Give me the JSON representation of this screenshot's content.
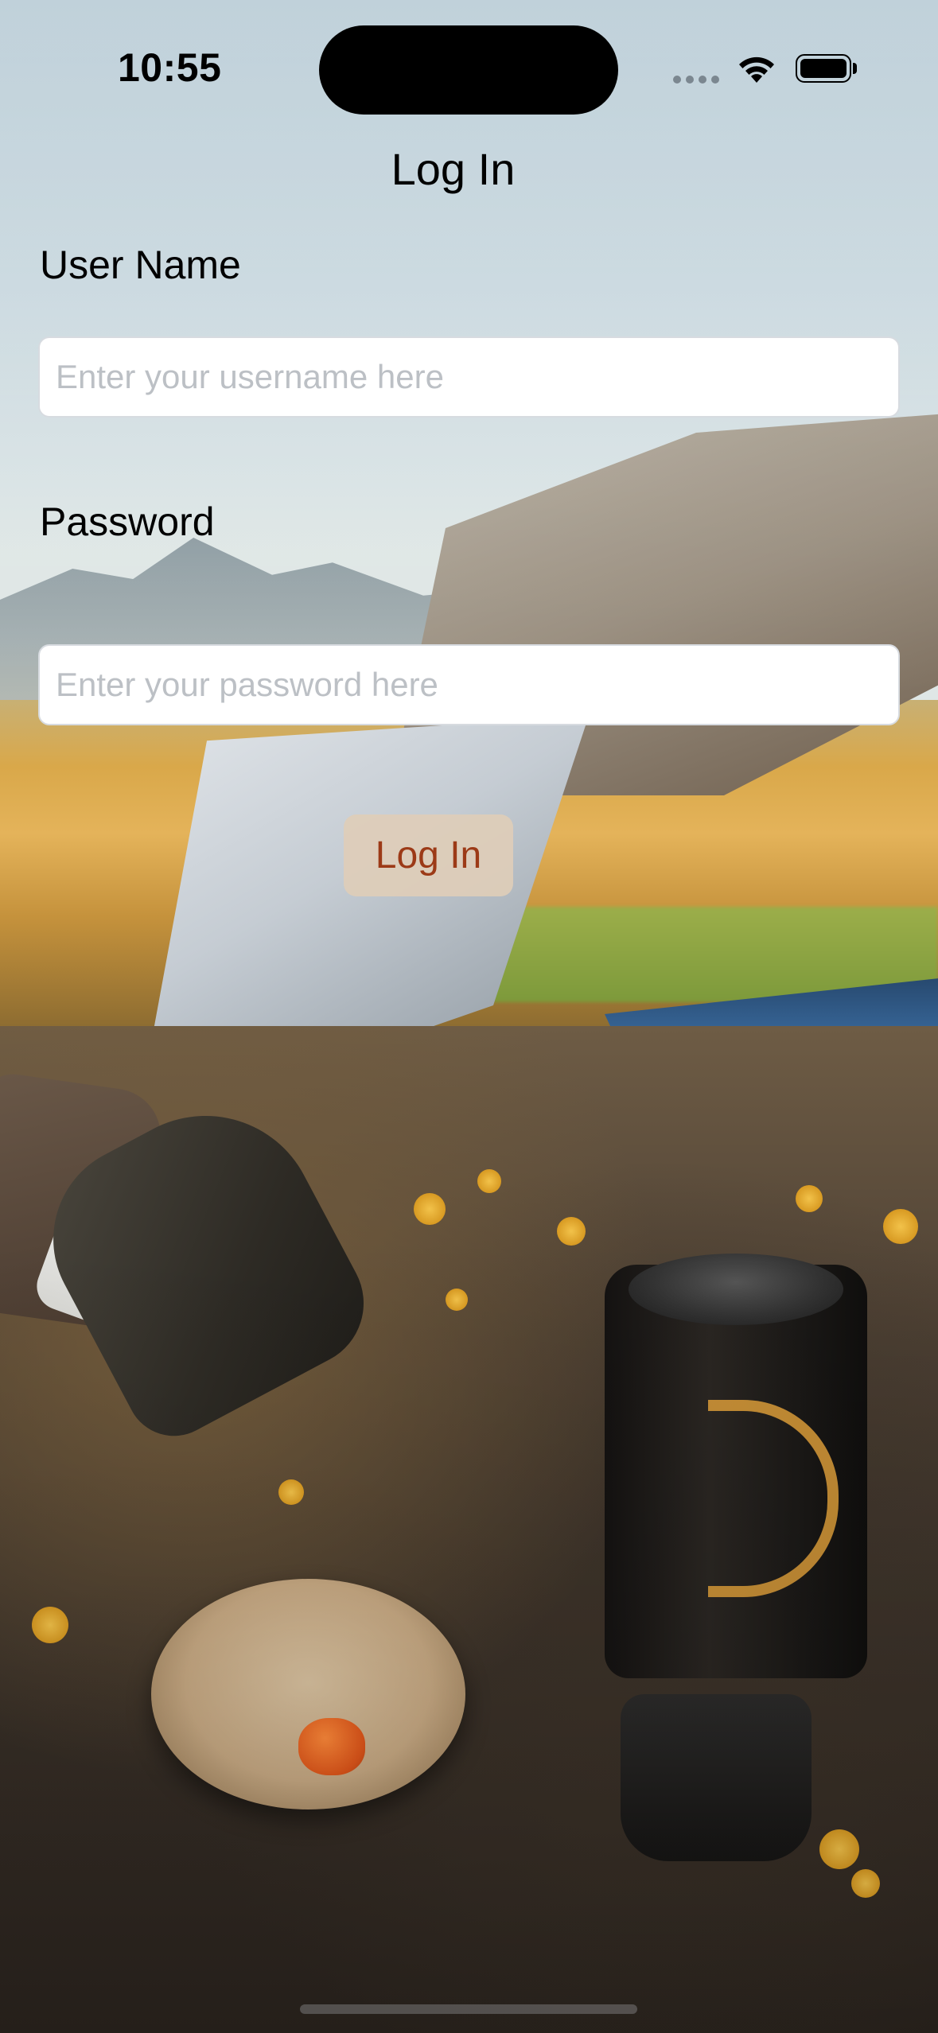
{
  "status_bar": {
    "time": "10:55",
    "icons": [
      "signal-dots-icon",
      "wifi-icon",
      "battery-icon"
    ],
    "battery_level": 1.0
  },
  "nav": {
    "title": "Log In"
  },
  "form": {
    "username_label": "User Name",
    "username_placeholder": "Enter your username here",
    "username_value": "",
    "password_label": "Password",
    "password_placeholder": "Enter your password here",
    "password_value": "",
    "login_button_label": "Log In"
  },
  "colors": {
    "accent_text": "#9c3a17",
    "button_background": "#decdb9",
    "input_background": "#ffffff",
    "input_border": "#d7dbe0",
    "placeholder": "#bcc0c5"
  }
}
